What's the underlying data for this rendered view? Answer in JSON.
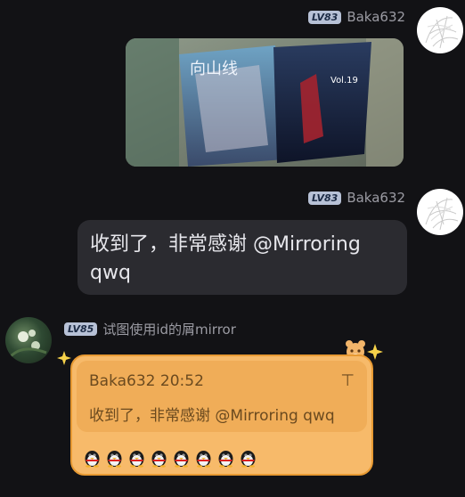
{
  "messages": [
    {
      "sender": "Baka632",
      "level": "LV83",
      "type": "image",
      "image_desc": "photo-of-two-books"
    },
    {
      "sender": "Baka632",
      "level": "LV83",
      "type": "text",
      "text_line1": "收到了，非常感谢 @Mirroring",
      "text_line2": "qwq"
    },
    {
      "sender": "试图使用id的屑mirror",
      "level": "LV85",
      "type": "reply",
      "quote_header": "Baka632 20:52",
      "quote_text": "收到了，非常感谢 @Mirroring qwq",
      "pin_glyph": "⊤",
      "penguin_count": 8
    }
  ],
  "colors": {
    "background": "#121215",
    "bubble": "#2b2b30",
    "reply_card": "#f7ba6a",
    "reply_border": "#e89a33",
    "level_badge": "#b7c1d6"
  }
}
